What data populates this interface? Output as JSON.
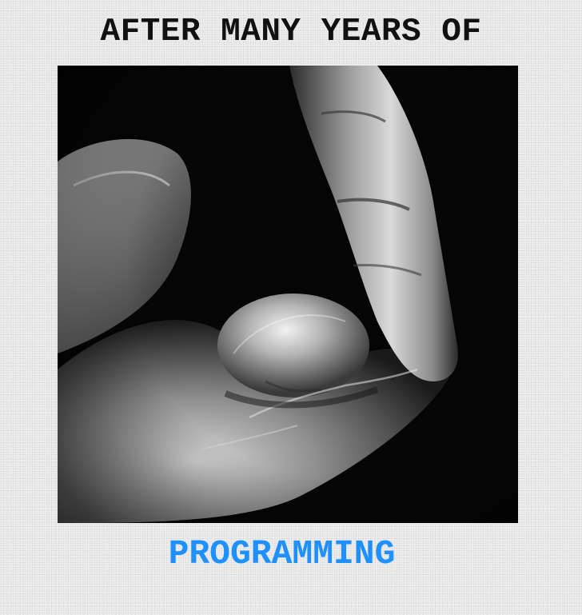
{
  "meme": {
    "top_text": "AFTER MANY YEARS OF",
    "bottom_text": "PROGRAMMING"
  },
  "colors": {
    "top_text": "#111111",
    "bottom_text": "#1e90ff",
    "background": "#ececec",
    "photo_background": "#000000"
  },
  "image": {
    "icon": "flexed-finger-photo"
  }
}
